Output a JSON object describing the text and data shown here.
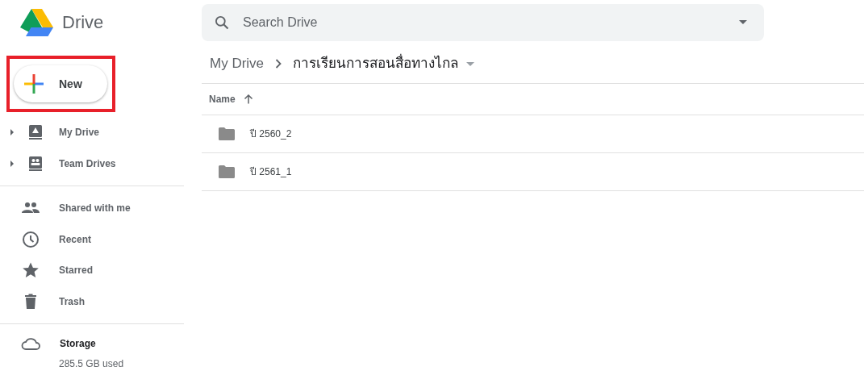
{
  "app": {
    "title": "Drive"
  },
  "search": {
    "placeholder": "Search Drive"
  },
  "new_button": {
    "label": "New",
    "highlighted": true
  },
  "drives": [
    {
      "label": "My Drive",
      "expanded": false
    },
    {
      "label": "Team Drives",
      "expanded": false
    }
  ],
  "nav_items": [
    {
      "label": "Shared with me",
      "selected": false
    },
    {
      "label": "Recent",
      "selected": false
    },
    {
      "label": "Starred",
      "selected": false
    },
    {
      "label": "Trash",
      "selected": false
    }
  ],
  "storage": {
    "title": "Storage",
    "used": "285.5 GB used"
  },
  "breadcrumb": [
    "My Drive",
    "การเรียนการสอนสื่อทางไกล"
  ],
  "table": {
    "columns": [
      {
        "label": "Name",
        "sorted_ascending": true
      }
    ],
    "rows": [
      {
        "name": "ปี 2560_2"
      },
      {
        "name": "ปี 2561_1"
      }
    ]
  }
}
